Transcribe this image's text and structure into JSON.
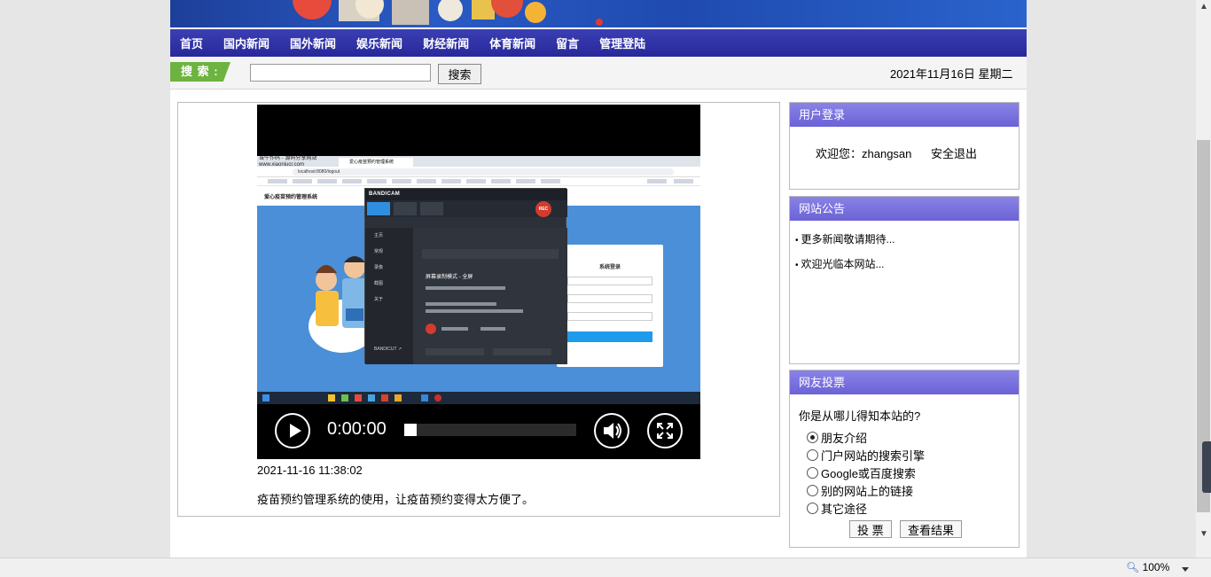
{
  "nav": [
    "首页",
    "国内新闻",
    "国外新闻",
    "娱乐新闻",
    "财经新闻",
    "体育新闻",
    "留言",
    "管理登陆"
  ],
  "search": {
    "label": "搜 索 :",
    "placeholder": "",
    "button": "搜索"
  },
  "date": "2021年11月16日 星期二",
  "video": {
    "time": "0:00:00",
    "progress": 0.0,
    "screen": {
      "site_top": "当牛作码 - 源码分享网站",
      "site_url_small": "www.xiaoniucr.com",
      "tab_title": "爱心疫苗预约管理系统",
      "address": "localhost:8080/logout",
      "site_title": "爱心疫苗预约管理系统",
      "login_title": "系统登录",
      "login_button": "登录",
      "recorder_name": "BANDICAM",
      "recorder_rec": "REC",
      "recorder_menu": [
        "主页",
        "常规",
        "录像",
        "截图",
        "关于"
      ],
      "recorder_mode_title": "屏幕录制模式 - 全屏",
      "recorder_footer": "BANDICUT ↗"
    }
  },
  "post": {
    "time": "2021-11-16 11:38:02",
    "text": "疫苗预约管理系统的使用，让疫苗预约变得太方便了。"
  },
  "login_panel": {
    "title": "用户登录",
    "welcome": "欢迎您：zhangsan",
    "logout": "安全退出"
  },
  "notice_panel": {
    "title": "网站公告",
    "items": [
      "更多新闻敬请期待...",
      "欢迎光临本网站..."
    ]
  },
  "vote_panel": {
    "title": "网友投票",
    "question": "你是从哪儿得知本站的?",
    "options": [
      "朋友介绍",
      "门户网站的搜索引擎",
      "Google或百度搜索",
      "别的网站上的链接",
      "其它途径"
    ],
    "selected": 0,
    "vote_button": "投 票",
    "result_button": "查看结果"
  },
  "statusbar": {
    "zoom": "100%"
  },
  "colors": {
    "nav": "#2f31a6",
    "panel_head": "#7a72de",
    "search_tag": "#6db33f"
  }
}
